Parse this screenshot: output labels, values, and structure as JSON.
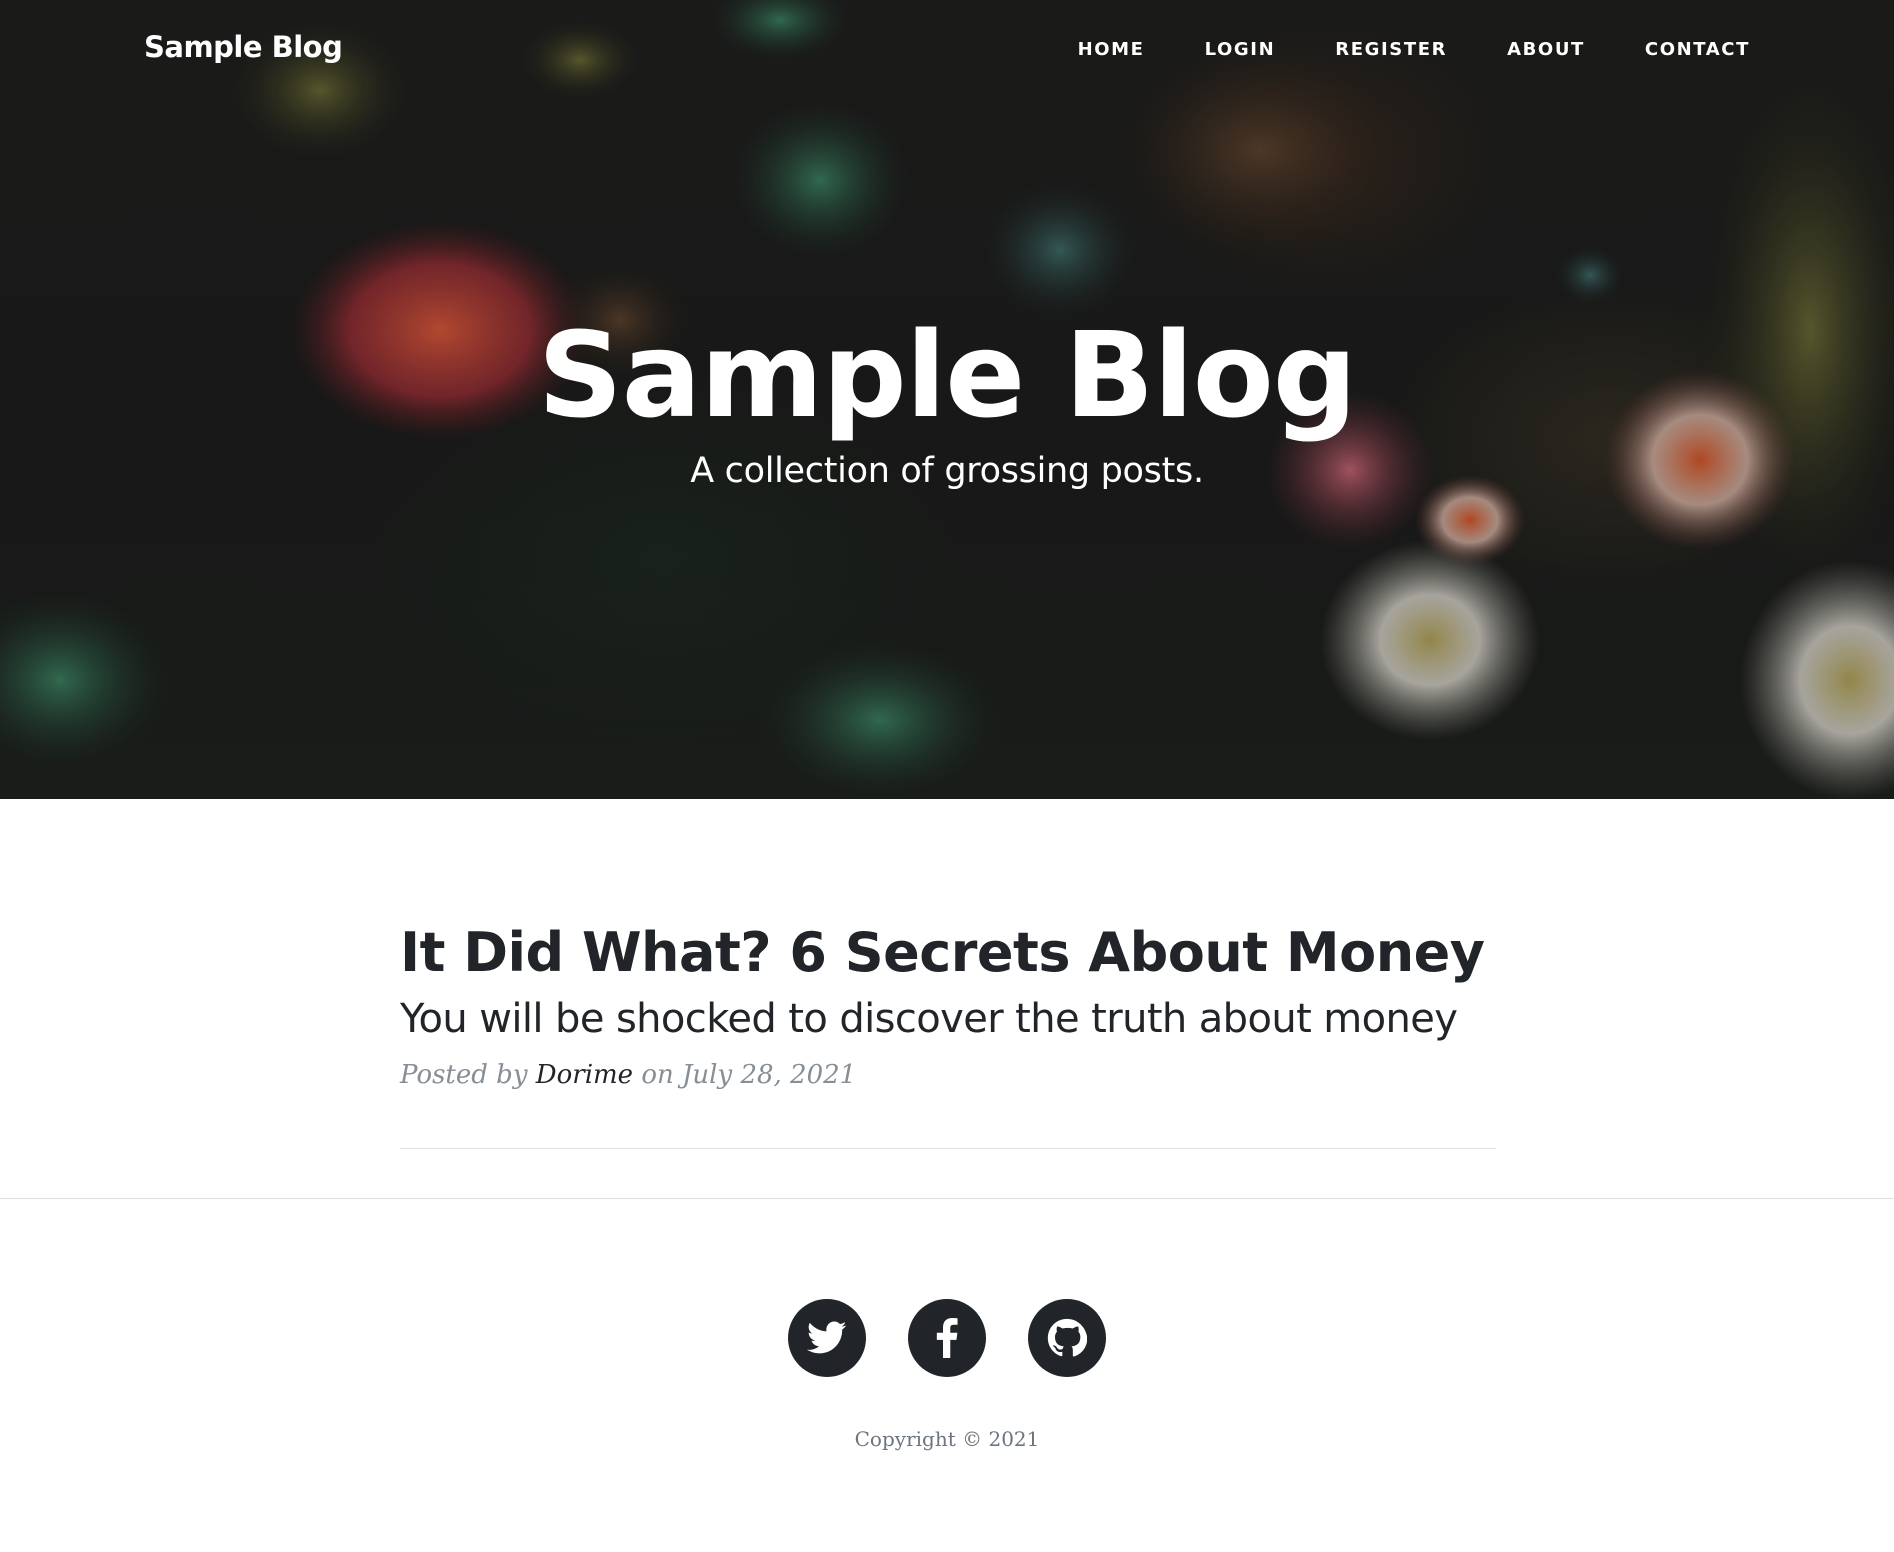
{
  "navbar": {
    "brand": "Sample Blog",
    "links": [
      {
        "label": "HOME"
      },
      {
        "label": "LOGIN"
      },
      {
        "label": "REGISTER"
      },
      {
        "label": "ABOUT"
      },
      {
        "label": "CONTACT"
      }
    ]
  },
  "hero": {
    "title": "Sample Blog",
    "subtitle": "A collection of grossing posts."
  },
  "posts": [
    {
      "title": "It Did What? 6 Secrets About Money",
      "subtitle": "You will be shocked to discover the truth about money",
      "meta_prefix": "Posted by",
      "author": "Dorime",
      "meta_suffix": "on July 28, 2021"
    }
  ],
  "footer": {
    "social": [
      {
        "name": "twitter",
        "icon": "twitter-icon"
      },
      {
        "name": "facebook",
        "icon": "facebook-icon"
      },
      {
        "name": "github",
        "icon": "github-icon"
      }
    ],
    "copyright": "Copyright © 2021"
  },
  "colors": {
    "text_dark": "#212529",
    "meta_gray": "#868e96",
    "footer_gray": "#6c757d",
    "hero_text": "#ffffff"
  }
}
